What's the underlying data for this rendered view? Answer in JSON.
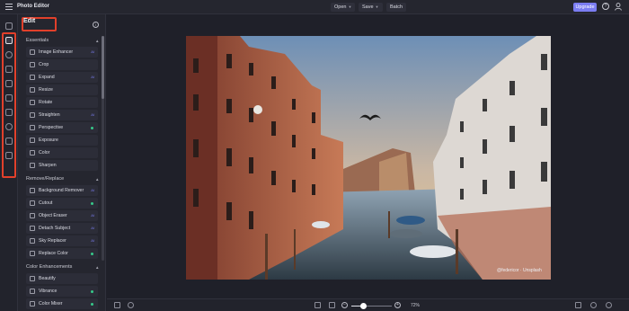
{
  "app": {
    "title": "Photo Editor"
  },
  "toolbar": {
    "open_label": "Open",
    "save_label": "Save",
    "batch_label": "Batch",
    "upgrade_label": "Upgrade",
    "help_icon": "help-circle-icon",
    "user_icon": "user-icon"
  },
  "rail": {
    "icons": [
      "layers-icon",
      "adjust-icon",
      "eye-icon",
      "brush-icon",
      "text-frame-icon",
      "image-icon",
      "grid-icon",
      "sticker-icon",
      "text-icon",
      "shape-icon"
    ]
  },
  "panel": {
    "title": "Edit",
    "sections": [
      {
        "title": "Essentials",
        "items": [
          {
            "label": "Image Enhancer",
            "badge": "AI"
          },
          {
            "label": "Crop"
          },
          {
            "label": "Expand",
            "badge": "AI"
          },
          {
            "label": "Resize"
          },
          {
            "label": "Rotate"
          },
          {
            "label": "Straighten",
            "badge": "AI"
          },
          {
            "label": "Perspective",
            "dot": true
          },
          {
            "label": "Exposure"
          },
          {
            "label": "Color"
          },
          {
            "label": "Sharpen"
          }
        ]
      },
      {
        "title": "Remove/Replace",
        "items": [
          {
            "label": "Background Remover",
            "badge": "AI"
          },
          {
            "label": "Cutout",
            "dot": true
          },
          {
            "label": "Object Eraser",
            "badge": "AI"
          },
          {
            "label": "Detach Subject",
            "badge": "AI"
          },
          {
            "label": "Sky Replacer",
            "badge": "AI"
          },
          {
            "label": "Replace Color",
            "dot": true
          }
        ]
      },
      {
        "title": "Color Enhancements",
        "items": [
          {
            "label": "Beautify"
          },
          {
            "label": "Vibrance",
            "dot": true
          },
          {
            "label": "Color Mixer",
            "dot": true
          }
        ]
      }
    ]
  },
  "photo": {
    "credit": "@federicor · Unsplash"
  },
  "bottom": {
    "zoom_value": "72%",
    "zoom_fraction": 0.3
  },
  "colors": {
    "accent": "#7b7df2",
    "highlight": "#e2402b",
    "background": "#1f2029"
  }
}
